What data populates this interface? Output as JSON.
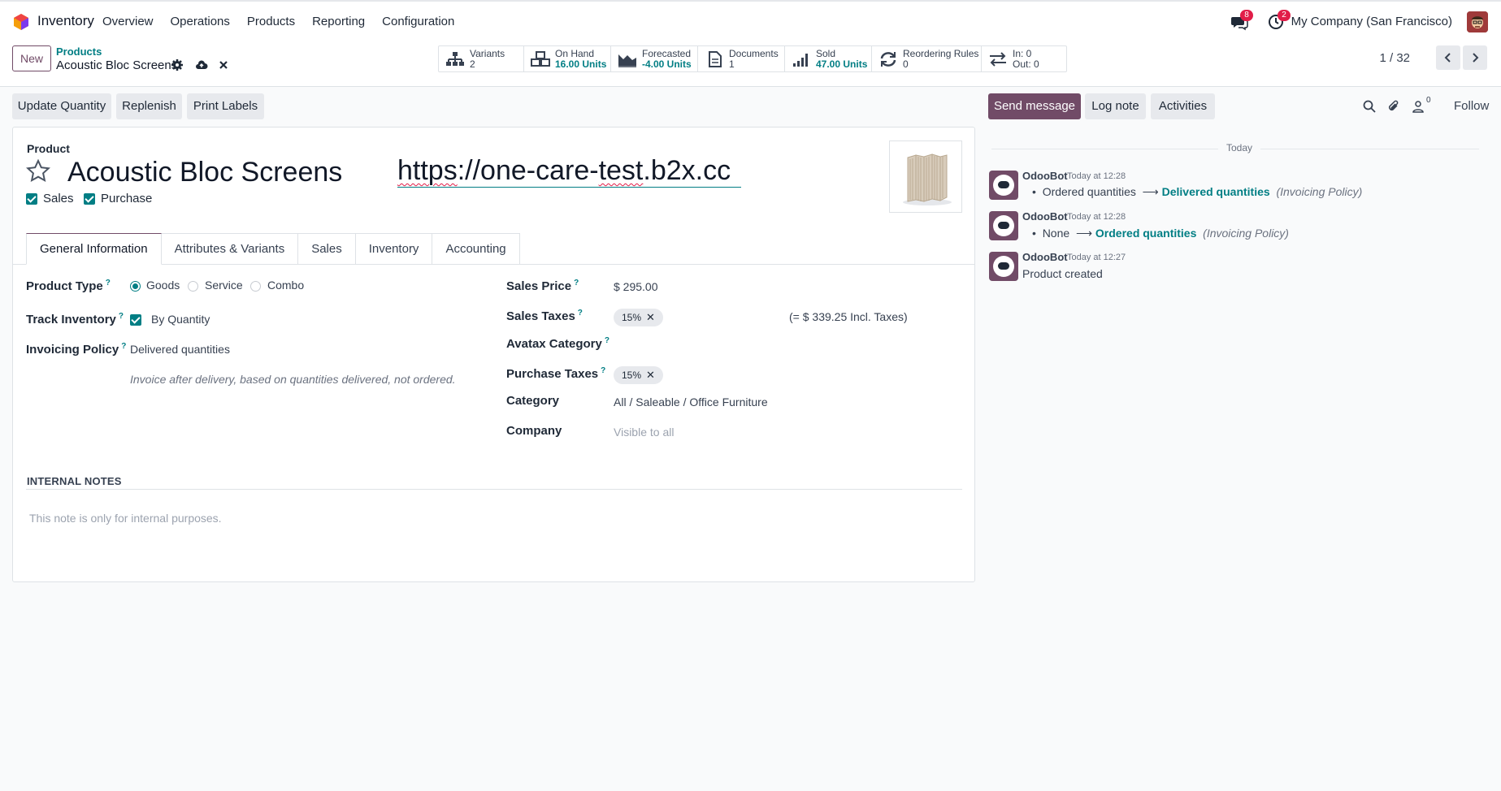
{
  "navbar": {
    "app_name": "Inventory",
    "menu": [
      "Overview",
      "Operations",
      "Products",
      "Reporting",
      "Configuration"
    ],
    "messages_badge": "8",
    "activities_badge": "2",
    "company": "My Company (San Francisco)"
  },
  "control": {
    "new_label": "New",
    "breadcrumb_parent": "Products",
    "breadcrumb_current": "Acoustic Bloc Screens",
    "stats": [
      {
        "label": "Variants",
        "value": "2",
        "icon": "variants-icon"
      },
      {
        "label": "On Hand",
        "value": "16.00 Units",
        "icon": "on-hand-icon"
      },
      {
        "label": "Forecasted",
        "value": "-4.00 Units",
        "icon": "forecast-icon"
      },
      {
        "label": "Documents",
        "value": "1",
        "icon": "document-icon"
      },
      {
        "label": "Sold",
        "value": "47.00 Units",
        "icon": "sold-icon"
      },
      {
        "label": "Reordering Rules",
        "value": "0",
        "icon": "reorder-icon"
      },
      {
        "label": "In: 0",
        "value": "Out: 0",
        "icon": "transfer-icon"
      }
    ],
    "pager": "1 / 32"
  },
  "actions": {
    "update_quantity": "Update Quantity",
    "replenish": "Replenish",
    "print_labels": "Print Labels",
    "send_message": "Send message",
    "log_note": "Log note",
    "activities": "Activities",
    "followers_count": "0",
    "follow": "Follow"
  },
  "form": {
    "product_label": "Product",
    "name": "Acoustic Bloc Screens",
    "url_prefix": "https",
    "url_rest": "://one-care-",
    "url_test": "test",
    "url_tail": ".b2x.cc",
    "sales_label": "Sales",
    "purchase_label": "Purchase",
    "tabs": [
      "General Information",
      "Attributes & Variants",
      "Sales",
      "Inventory",
      "Accounting"
    ],
    "product_type_label": "Product Type",
    "product_type_options": [
      "Goods",
      "Service",
      "Combo"
    ],
    "track_inventory_label": "Track Inventory",
    "track_inventory_value": "By Quantity",
    "invoicing_policy_label": "Invoicing Policy",
    "invoicing_policy_value": "Delivered quantities",
    "invoicing_policy_help": "Invoice after delivery, based on quantities delivered, not ordered.",
    "sales_price_label": "Sales Price",
    "sales_price_value": "$ 295.00",
    "sales_taxes_label": "Sales Taxes",
    "sales_taxes_tag": "15%",
    "sales_taxes_incl": "(= $ 339.25 Incl. Taxes)",
    "avatax_label": "Avatax Category",
    "purchase_taxes_label": "Purchase Taxes",
    "purchase_taxes_tag": "15%",
    "category_label": "Category",
    "category_value": "All / Saleable / Office Furniture",
    "company_label": "Company",
    "company_placeholder": "Visible to all",
    "internal_notes_title": "INTERNAL NOTES",
    "internal_notes_placeholder": "This note is only for internal purposes.",
    "help_mark": "?"
  },
  "chatter": {
    "today": "Today",
    "messages": [
      {
        "author": "OdooBot",
        "time": "Today at 12:28",
        "old": "Ordered quantities",
        "new": "Delivered quantities",
        "field": "(Invoicing Policy)"
      },
      {
        "author": "OdooBot",
        "time": "Today at 12:28",
        "old": "None",
        "new": "Ordered quantities",
        "field": "(Invoicing Policy)"
      },
      {
        "author": "OdooBot",
        "time": "Today at 12:27",
        "body": "Product created"
      }
    ],
    "arrow": "⟶",
    "bullet": "•"
  },
  "colors": {
    "primary": "#714b67",
    "accent": "#017e84",
    "badge": "#e11d48"
  }
}
